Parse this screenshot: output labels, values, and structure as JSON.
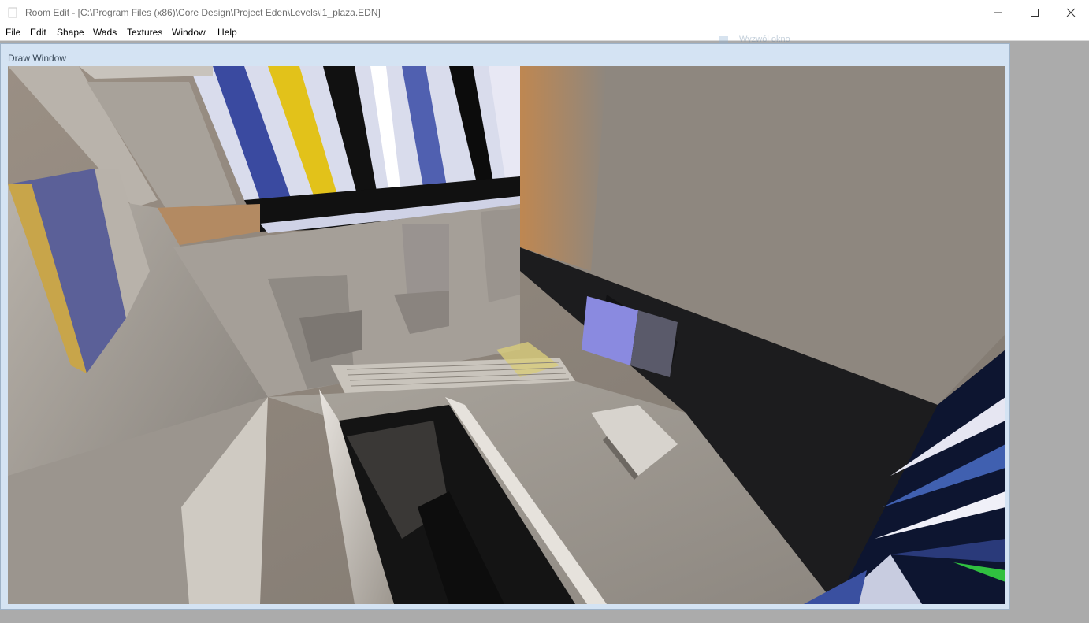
{
  "window": {
    "title": "Room Edit - [C:\\Program Files (x86)\\Core Design\\Project Eden\\Levels\\l1_plaza.EDN]",
    "app_icon": "document-icon",
    "controls": [
      "minimize-icon",
      "maximize-icon",
      "close-icon"
    ]
  },
  "menu": {
    "items": [
      "File",
      "Edit",
      "Shape",
      "Wads",
      "Textures",
      "Window",
      "Help"
    ]
  },
  "ghost_tab": {
    "label": "Wyzwól okno"
  },
  "draw_window": {
    "title": "Draw Window",
    "scene": "3d-room-viewport"
  },
  "colors": {
    "titlebar": "#ffffff",
    "client_bg": "#ababab",
    "mdi_frame": "#d4e3f3"
  }
}
